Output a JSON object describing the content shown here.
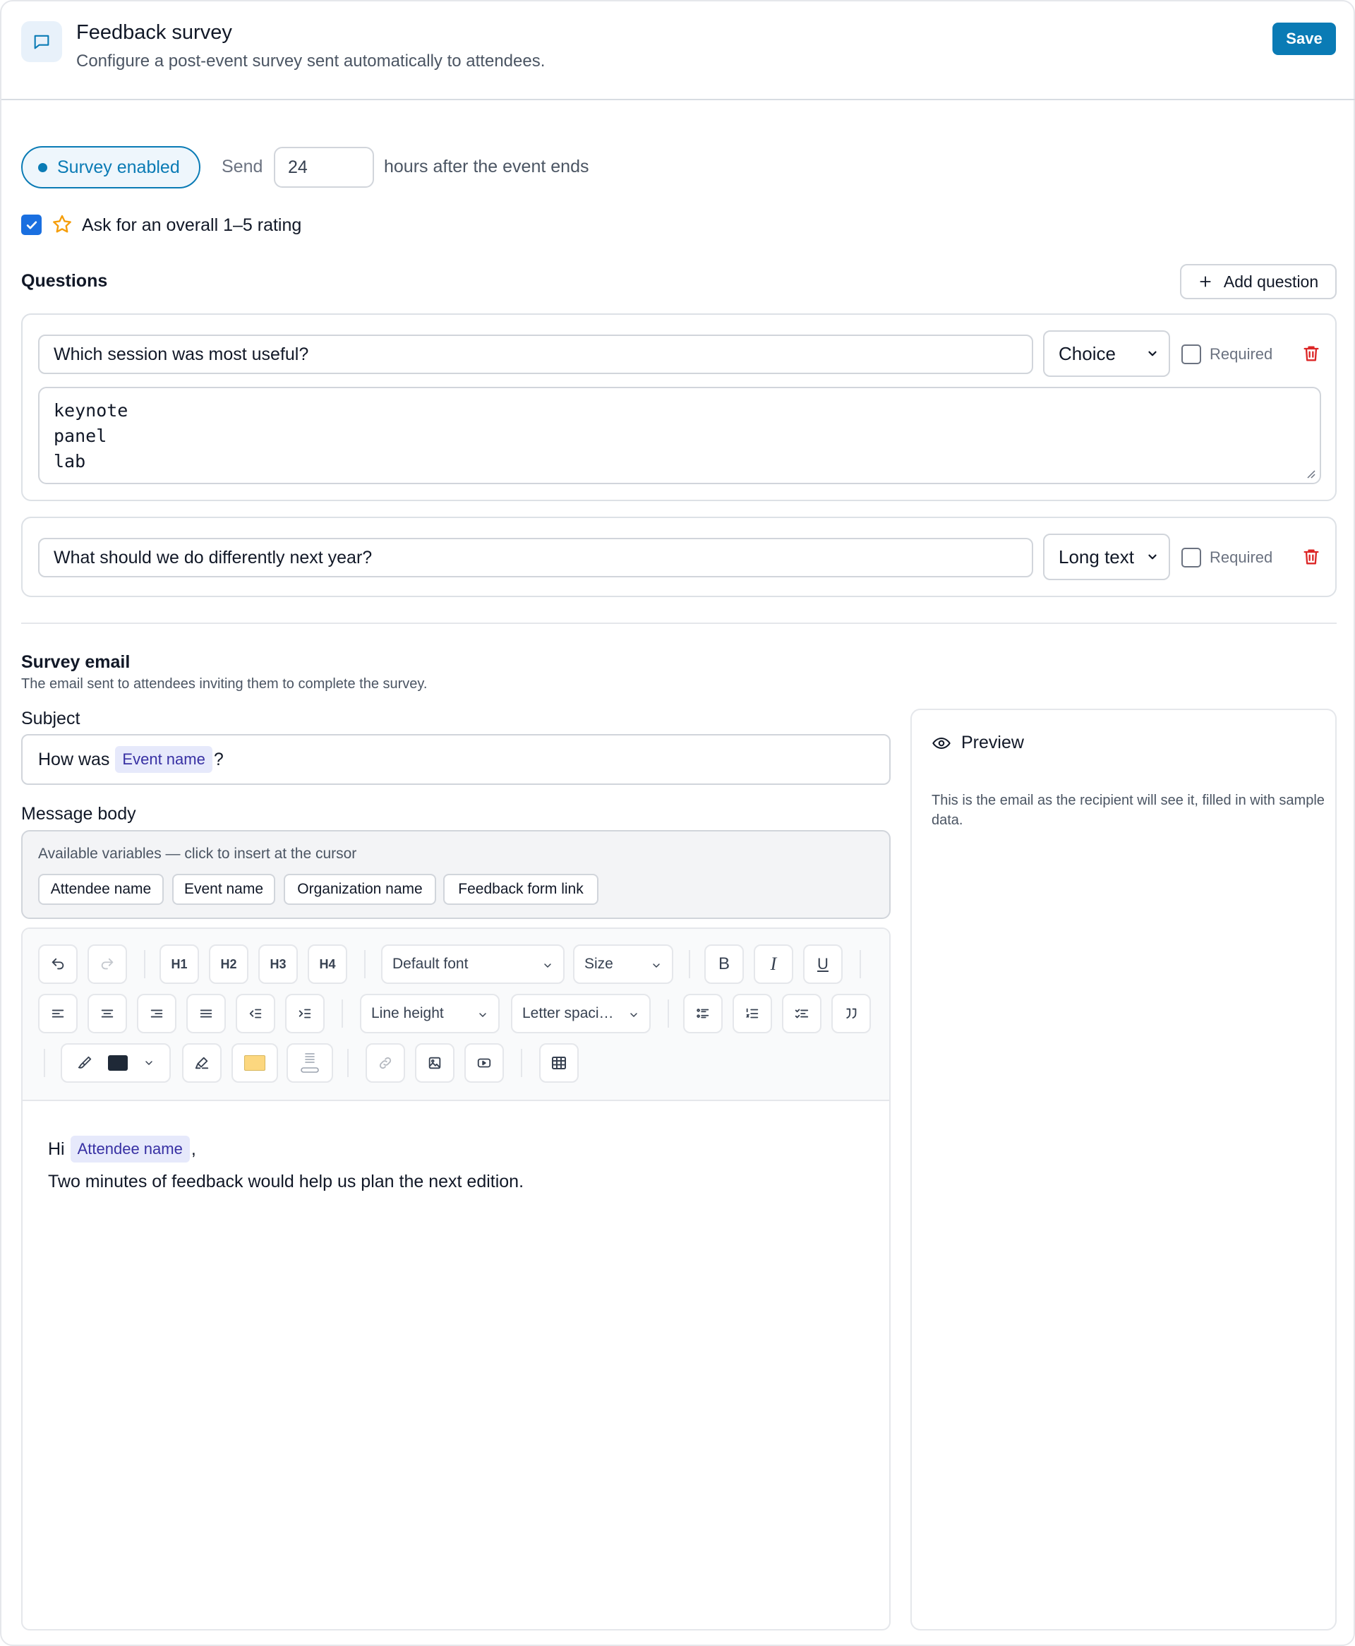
{
  "header": {
    "title": "Feedback survey",
    "subtitle": "Configure a post-event survey sent automatically to attendees.",
    "icon": "chat-bubble-icon",
    "save_label": "Save"
  },
  "schedule": {
    "status_label": "Survey enabled",
    "send_label": "Send",
    "hours_value": "24",
    "after_label": "hours after the event ends"
  },
  "rating": {
    "checked": true,
    "label": "Ask for an overall 1–5 rating"
  },
  "questions": {
    "title": "Questions",
    "add_label": "Add question",
    "items": [
      {
        "text": "Which session was most useful?",
        "type": "Choice",
        "required_label": "Required",
        "required": false,
        "options": [
          "keynote",
          "panel",
          "lab"
        ]
      },
      {
        "text": "What should we do differently next year?",
        "type": "Long text",
        "required_label": "Required",
        "required": false
      }
    ]
  },
  "survey_email": {
    "title": "Survey email",
    "subtitle": "The email sent to attendees inviting them to complete the survey.",
    "subject_label": "Subject",
    "subject_prefix": "How was",
    "subject_var": "Event name",
    "subject_suffix": "?",
    "body_label": "Message body",
    "vars_hint": "Available variables — click to insert at the cursor",
    "variables": [
      "Attendee name",
      "Event name",
      "Organization name",
      "Feedback form link"
    ]
  },
  "toolbar": {
    "headings": [
      "H1",
      "H2",
      "H3",
      "H4"
    ],
    "font_select": "Default font",
    "size_select": "Size",
    "bold": "B",
    "italic": "I",
    "underline": "U",
    "line_height_select": "Line height",
    "letter_spacing_select": "Letter spaci…",
    "text_color": "#1f2937",
    "highlight_color": "#fcd77f"
  },
  "editor": {
    "greeting": "Hi",
    "greeting_var": "Attendee name",
    "greeting_suffix": ",",
    "line2": "Two minutes of feedback would help us plan the next edition."
  },
  "preview": {
    "title": "Preview",
    "description": "This is the email as the recipient will see it, filled in with sample data."
  },
  "colors": {
    "accent": "#0a7bb5",
    "checkbox": "#1a6fe0",
    "danger": "#dc2626",
    "variable_chip_bg": "#e6e9fb",
    "variable_chip_text": "#3730a3"
  }
}
